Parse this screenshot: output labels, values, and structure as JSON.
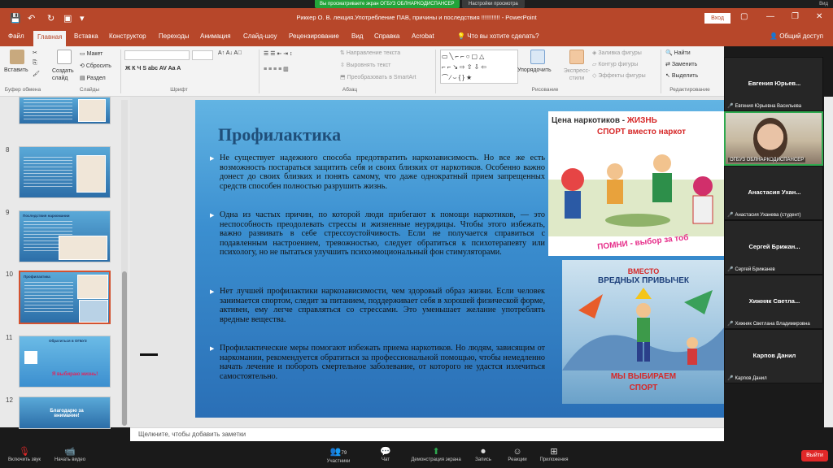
{
  "zoom_top": {
    "share_label": "Вы просматриваете экран ОГБУЗ ОБЛНАРКОДИСПАНСЕР",
    "settings_label": "Настройки просмотра",
    "view_label": "Вид"
  },
  "window": {
    "title": "Риккер О. В. лекция.Употребление ПАВ, причины и последствия  !!!!!!!!!!!  -  PowerPoint",
    "login_label": "Вход"
  },
  "tabs": [
    "Файл",
    "Главная",
    "Вставка",
    "Конструктор",
    "Переходы",
    "Анимация",
    "Слайд-шоу",
    "Рецензирование",
    "Вид",
    "Справка",
    "Acrobat"
  ],
  "tell_me": "Что вы хотите сделать?",
  "share_access": "Общий доступ",
  "ribbon": {
    "paste": "Вставить",
    "new_slide": "Создать слайд",
    "layout": "Макет",
    "reset": "Сбросить",
    "section": "Раздел",
    "text_direction": "Направление текста",
    "align_text": "Выровнять текст",
    "smartart": "Преобразовать в SmartArt",
    "arrange": "Упорядочить",
    "express_styles": "Экспресс-стили",
    "shape_fill": "Заливка фигуры",
    "shape_outline": "Контур фигуры",
    "shape_effects": "Эффекты фигуры",
    "find": "Найти",
    "replace": "Заменить",
    "select": "Выделить",
    "groups": {
      "clipboard": "Буфер обмена",
      "slides": "Слайды",
      "font": "Шрифт",
      "paragraph": "Абзац",
      "drawing": "Рисование",
      "editing": "Редактирование"
    }
  },
  "thumbnails": [
    {
      "num": "",
      "title": ""
    },
    {
      "num": "8",
      "title": ""
    },
    {
      "num": "9",
      "title": "Последствия наркомании"
    },
    {
      "num": "10",
      "title": "Профилактика"
    },
    {
      "num": "11",
      "title": "Обратиться в ОГБУЗ",
      "label": "Я выбираю жизнь!"
    },
    {
      "num": "12",
      "title": "Благодарю за внимание!"
    }
  ],
  "slide": {
    "title": "Профилактика",
    "bullets": [
      "Не существует надежного способа предотвратить наркозависимость. Но все же есть возможность постараться защитить себя и своих близких от наркотиков. Особенно важно донест до своих близких и понять самому, что даже однократный прием запрещенных средств способен полностью разрушить жизнь.",
      "Одна из частых причин, по которой люди прибегают к помощи наркотиков, — это неспособность преодолевать стрессы и жизненные неурядицы. Чтобы этого избежать, важно развивать в себе стрессоустойчивость. Если не получается справиться с подавленным настроением, тревожностью, следует обратиться к психотерапевту или психологу, но не пытаться улучшить психоэмоциональный фон стимуляторами.",
      "Нет лучшей профилактики наркозависимости, чем здоровый образ жизни. Если человек занимается спортом, следит за питанием, поддерживает себя в хорошей физической форме, активен, ему легче справляться со стрессами. Это уменьшает желание употреблять вредные вещества.",
      "Профилактические меры помогают избежать приема наркотиков. Но людям, зависящим от наркомании, рекомендуется обратиться за профессиональной помощью, чтобы немедленно начать лечение и побороть смертельное заболевание, от которого не удастся излечиться самостоятельно."
    ],
    "poster1": {
      "title_a": "Цена наркотиков - ",
      "title_b": "ЖИЗНЬ",
      "subtitle": "СПОРТ вместо наркот",
      "footer": "ПОМНИ - выбор за тоб"
    },
    "poster2": {
      "title1": "ВМЕСТО",
      "title2": "ВРЕДНЫХ ПРИВЫЧЕК",
      "footer1": "МЫ ВЫБИРАЕМ",
      "footer2": "СПОРТ"
    }
  },
  "notes_placeholder": "Щелкните, чтобы добавить заметки",
  "participants": [
    {
      "name": "Евгения  Юрьев...",
      "label": "Евгения Юрьевна Васильева"
    },
    {
      "video": true,
      "label": "ОГБУЗ ОБЛНАРКОДИСПАНСЕР"
    },
    {
      "name": "Анастасия  Ухан...",
      "label": "Анастасия Уханева (студент)"
    },
    {
      "name": "Сергей  Брижан...",
      "label": "Сергей Брижанев"
    },
    {
      "name": "Хижняк  Светла...",
      "label": "Хижняк Светлана Владимировна"
    },
    {
      "name": "Карпов Данил",
      "label": "Карпов Данил"
    }
  ],
  "zoom_bottom": {
    "mute": "Включить звук",
    "video": "Начать видео",
    "participants": "Участники",
    "participants_count": "79",
    "chat": "Чат",
    "share": "Демонстрация экрана",
    "record": "Запись",
    "reactions": "Реакции",
    "apps": "Приложения",
    "exit": "Выйти"
  },
  "colors": {
    "ppt_accent": "#b7472a",
    "share_green": "#23a43a",
    "exit_red": "#e02828",
    "slide_title": "#1f4e79"
  }
}
